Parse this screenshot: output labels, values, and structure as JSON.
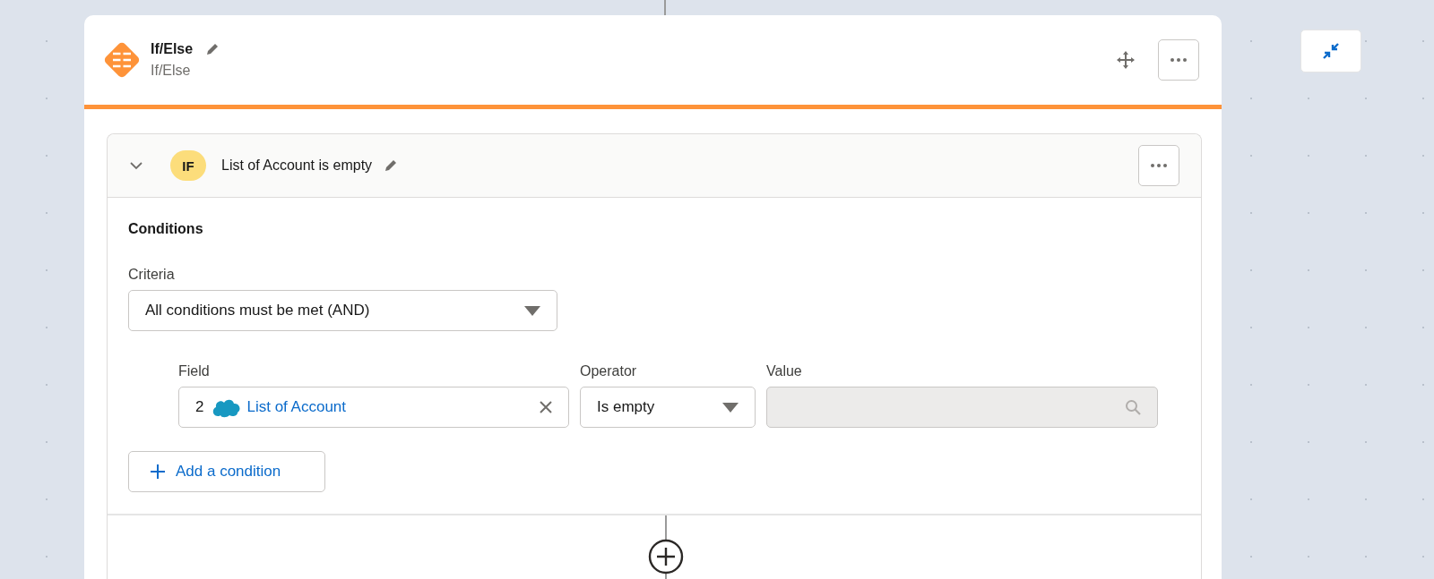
{
  "node": {
    "title": "If/Else",
    "subtitle": "If/Else"
  },
  "outcome": {
    "badge": "IF",
    "label": "List of Account is empty",
    "expanded": true,
    "conditions_heading": "Conditions",
    "criteria": {
      "label": "Criteria",
      "value": "All conditions must be met (AND)"
    },
    "condition_rows": [
      {
        "field": {
          "label": "Field",
          "index": "2",
          "value": "List of Account"
        },
        "operator": {
          "label": "Operator",
          "value": "Is empty"
        },
        "value": {
          "label": "Value",
          "disabled": true
        }
      }
    ],
    "add_button": "Add a condition"
  }
}
